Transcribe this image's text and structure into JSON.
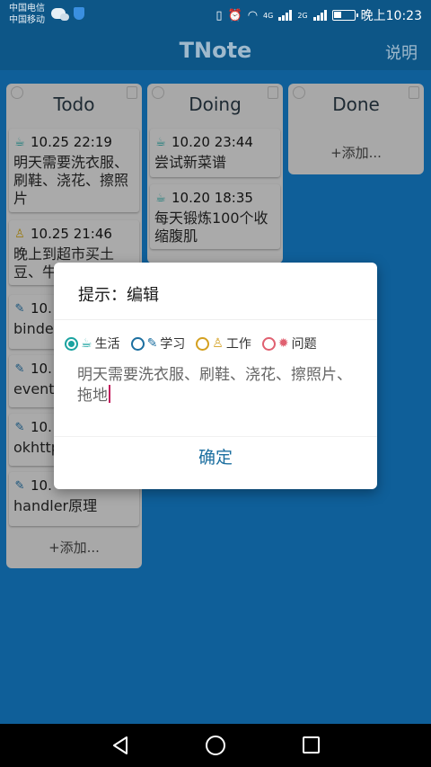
{
  "status_bar": {
    "carrier_1": "中国电信",
    "carrier_2": "中国移动",
    "network_1": "4G",
    "network_2": "2G",
    "time": "晚上10:23"
  },
  "app": {
    "title": "TNote",
    "help_label": "说明"
  },
  "columns": {
    "todo": {
      "title": "Todo",
      "add_label": "+添加...",
      "cards": [
        {
          "icon": "coffee-icon",
          "time": "10.25 22:19",
          "text": "明天需要洗衣服、刷鞋、浇花、擦照片"
        },
        {
          "icon": "worker-icon",
          "time": "10.25 21:46",
          "text": "晚上到超市买土豆、牛"
        },
        {
          "icon": "pencil-icon",
          "time": "10.",
          "text": "binde"
        },
        {
          "icon": "pencil-icon",
          "time": "10.",
          "text": "event"
        },
        {
          "icon": "pencil-icon",
          "time": "10.",
          "text": "okhttp"
        },
        {
          "icon": "pencil-icon",
          "time": "10.",
          "text": "handler原理"
        }
      ]
    },
    "doing": {
      "title": "Doing",
      "cards": [
        {
          "icon": "coffee-icon",
          "time": "10.20 23:44",
          "text": "尝试新菜谱"
        },
        {
          "icon": "coffee-icon",
          "time": "10.20 18:35",
          "text": "每天锻炼100个收缩腹肌"
        }
      ]
    },
    "done": {
      "title": "Done",
      "add_label": "+添加..."
    }
  },
  "dialog": {
    "title": "提示：编辑",
    "categories": [
      {
        "label": "生活",
        "icon": "coffee-icon",
        "color": "#1aa3a0",
        "checked": true
      },
      {
        "label": "学习",
        "icon": "pencil-icon",
        "color": "#1c6fa0",
        "checked": false
      },
      {
        "label": "工作",
        "icon": "worker-icon",
        "color": "#d4a020",
        "checked": false
      },
      {
        "label": "问题",
        "icon": "bug-icon",
        "color": "#e06070",
        "checked": false
      }
    ],
    "edit_text": "明天需要洗衣服、刷鞋、浇花、擦照片、拖地",
    "confirm_label": "确定"
  },
  "colors": {
    "background": "#0f5f99",
    "card": "#aaaaaa",
    "accent": "#1c6fa0"
  }
}
